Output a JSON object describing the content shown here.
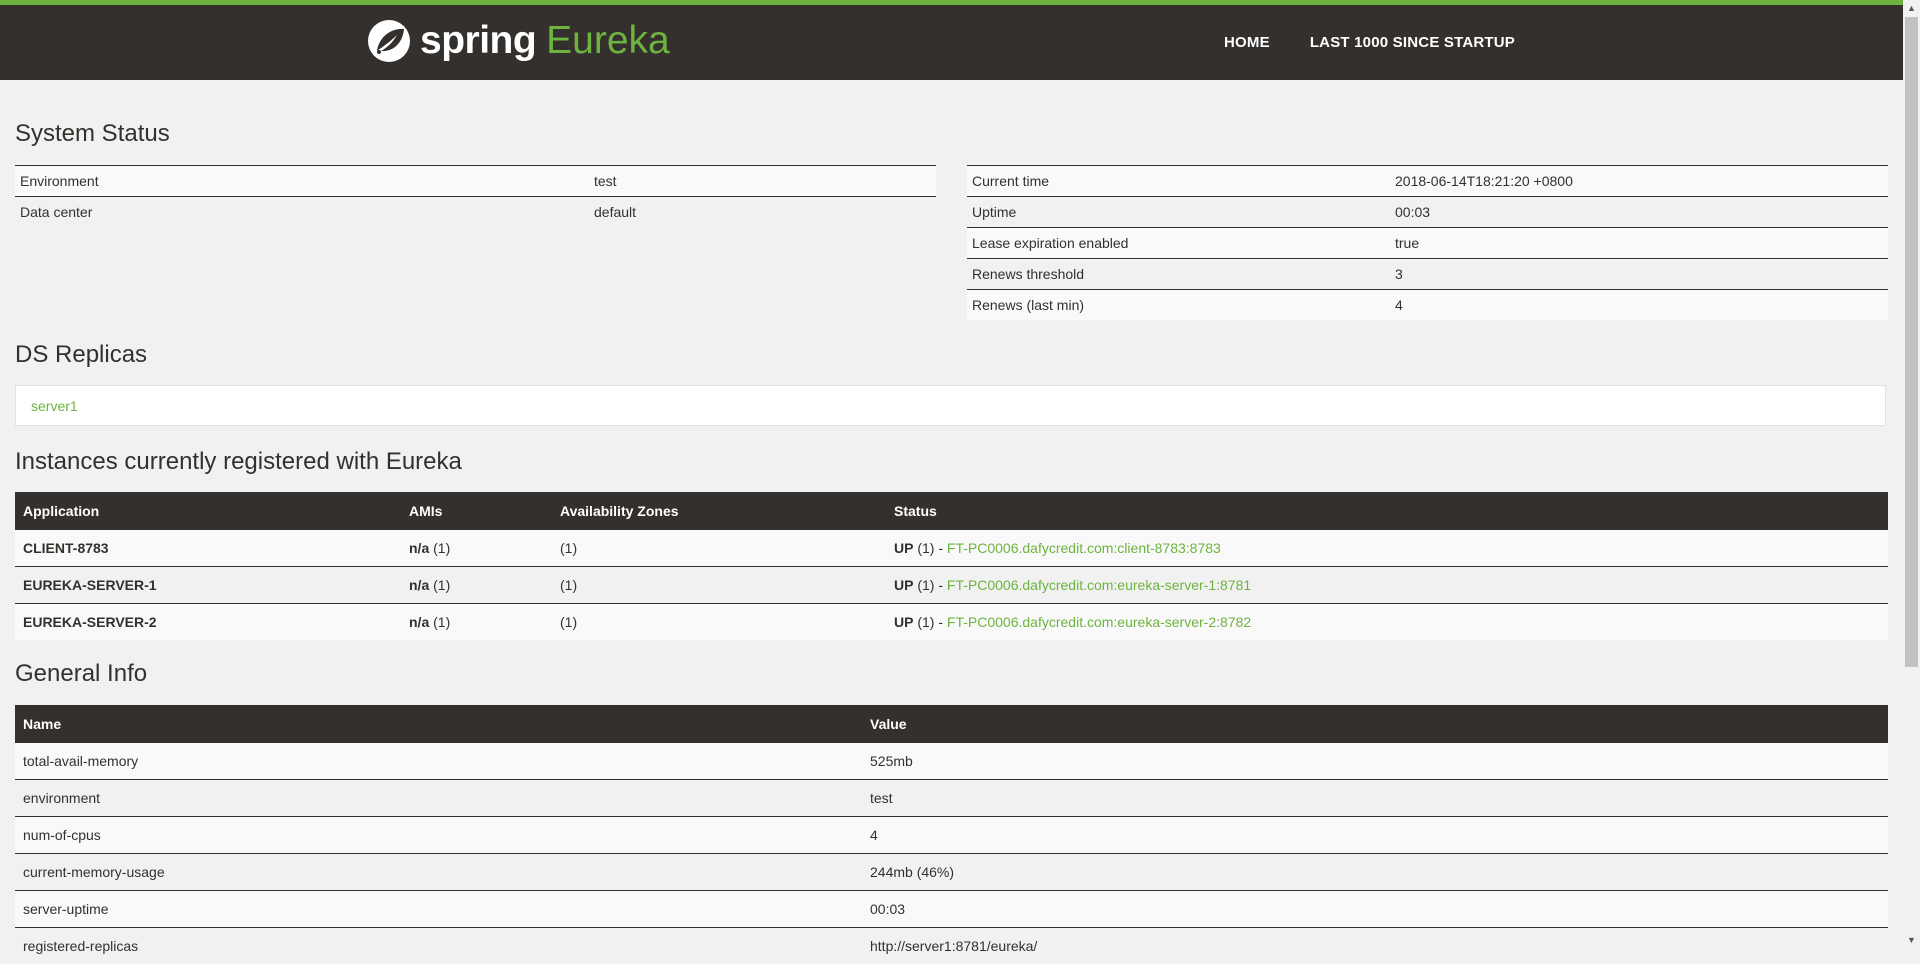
{
  "colors": {
    "brand_green": "#6db33f",
    "nav_dark": "#34302d"
  },
  "navbar": {
    "logo_icon": "spring-leaf-icon",
    "brand_spring": "spring",
    "brand_eureka": "Eureka",
    "links": [
      "HOME",
      "LAST 1000 SINCE STARTUP"
    ]
  },
  "system_status": {
    "title": "System Status",
    "left": [
      {
        "label": "Environment",
        "value": "test"
      },
      {
        "label": "Data center",
        "value": "default"
      }
    ],
    "right": [
      {
        "label": "Current time",
        "value": "2018-06-14T18:21:20 +0800"
      },
      {
        "label": "Uptime",
        "value": "00:03"
      },
      {
        "label": "Lease expiration enabled",
        "value": "true"
      },
      {
        "label": "Renews threshold",
        "value": "3"
      },
      {
        "label": "Renews (last min)",
        "value": "4"
      }
    ]
  },
  "replicas": {
    "title": "DS Replicas",
    "items": [
      "server1"
    ]
  },
  "instances": {
    "title": "Instances currently registered with Eureka",
    "headers": [
      "Application",
      "AMIs",
      "Availability Zones",
      "Status"
    ],
    "rows": [
      {
        "app": "CLIENT-8783",
        "ami_bold": "n/a",
        "ami_count": " (1)",
        "zones": "(1)",
        "status_bold": "UP",
        "status_count": " (1) - ",
        "link": "FT-PC0006.dafycredit.com:client-8783:8783"
      },
      {
        "app": "EUREKA-SERVER-1",
        "ami_bold": "n/a",
        "ami_count": " (1)",
        "zones": "(1)",
        "status_bold": "UP",
        "status_count": " (1) - ",
        "link": "FT-PC0006.dafycredit.com:eureka-server-1:8781"
      },
      {
        "app": "EUREKA-SERVER-2",
        "ami_bold": "n/a",
        "ami_count": " (1)",
        "zones": "(1)",
        "status_bold": "UP",
        "status_count": " (1) - ",
        "link": "FT-PC0006.dafycredit.com:eureka-server-2:8782"
      }
    ]
  },
  "general_info": {
    "title": "General Info",
    "headers": [
      "Name",
      "Value"
    ],
    "rows": [
      {
        "name": "total-avail-memory",
        "value": "525mb"
      },
      {
        "name": "environment",
        "value": "test"
      },
      {
        "name": "num-of-cpus",
        "value": "4"
      },
      {
        "name": "current-memory-usage",
        "value": "244mb (46%)"
      },
      {
        "name": "server-uptime",
        "value": "00:03"
      },
      {
        "name": "registered-replicas",
        "value": "http://server1:8781/eureka/"
      }
    ]
  }
}
